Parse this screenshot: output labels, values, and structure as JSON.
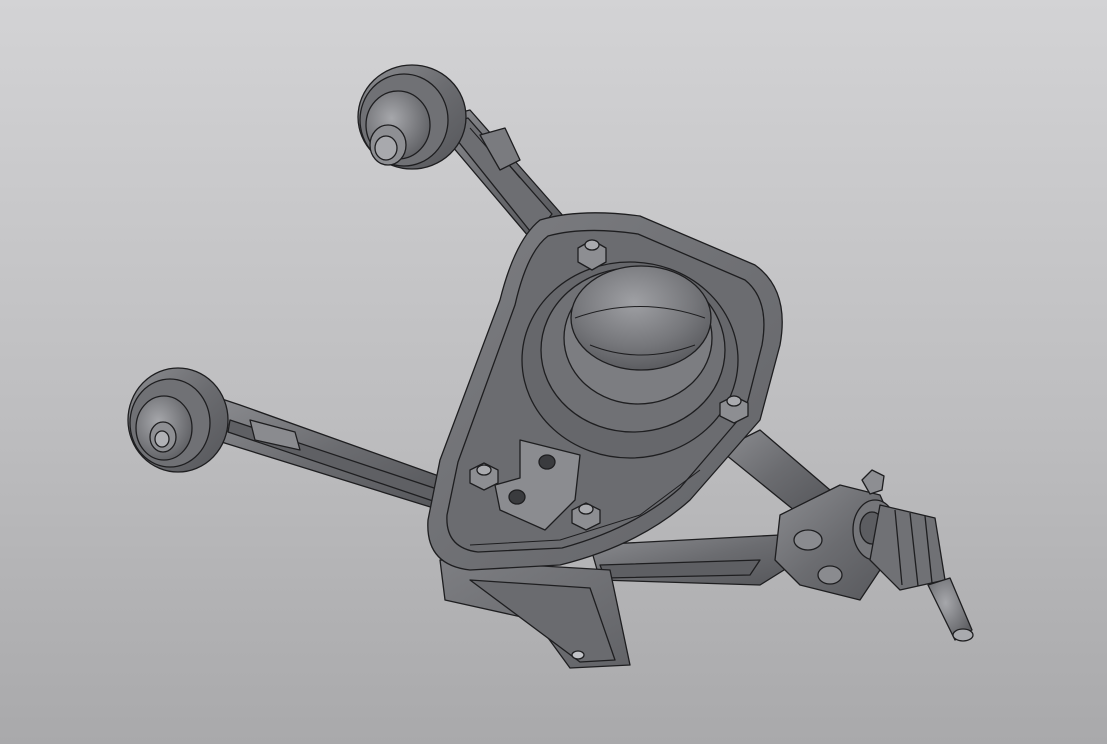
{
  "viewport": {
    "background_top": "#d3d3d5",
    "background_bottom": "#a9a9ab"
  },
  "model": {
    "part_fill_dark": "#5d5e61",
    "part_fill_mid": "#727377",
    "part_fill_light": "#9a9ba0",
    "edge_color": "#1e1e20"
  }
}
